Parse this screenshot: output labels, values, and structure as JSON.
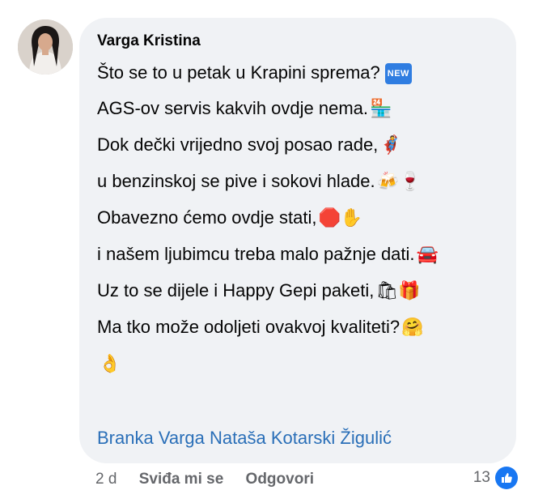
{
  "comment": {
    "author": "Varga Kristina",
    "lines": [
      {
        "text": "Što se to u petak u Krapini sprema?",
        "emoji": "🆕",
        "emoji_name": "new-badge-icon"
      },
      {
        "text": "AGS-ov servis kakvih ovdje nema.",
        "emoji": "🏪",
        "emoji_name": "convenience-store-icon"
      },
      {
        "text": "Dok dečki vrijedno svoj posao rade,",
        "emoji": "🦸",
        "emoji_name": "superhero-icon"
      },
      {
        "text": "u benzinskoj se pive i sokovi hlade.",
        "emoji": "🍻🍷",
        "emoji_name": "drinks-icon"
      },
      {
        "text": "Obavezno ćemo ovdje stati,",
        "emoji": "🛑✋",
        "emoji_name": "stop-hand-icon"
      },
      {
        "text": "i našem ljubimcu treba malo pažnje dati.",
        "emoji": "🚘",
        "emoji_name": "car-icon"
      },
      {
        "text": "Uz to se dijele i Happy Gepi paketi,",
        "emoji": "🛍🎁",
        "emoji_name": "gifts-icon"
      },
      {
        "text": "Ma tko može odoljeti ovakvoj kvaliteti?",
        "emoji": "🤗",
        "emoji_name": "hugging-face-icon"
      },
      {
        "text": "",
        "emoji": "👌",
        "emoji_name": "ok-hand-icon"
      }
    ],
    "mentions": [
      "Branka Varga",
      "Nataša Kotarski Žigulić"
    ]
  },
  "actions": {
    "time": "2 d",
    "like_label": "Sviđa mi se",
    "reply_label": "Odgovori",
    "reaction_count": "13"
  },
  "colors": {
    "bubble": "#f0f2f5",
    "mention": "#2a6fb8",
    "meta": "#65676b",
    "like": "#1877f2"
  }
}
